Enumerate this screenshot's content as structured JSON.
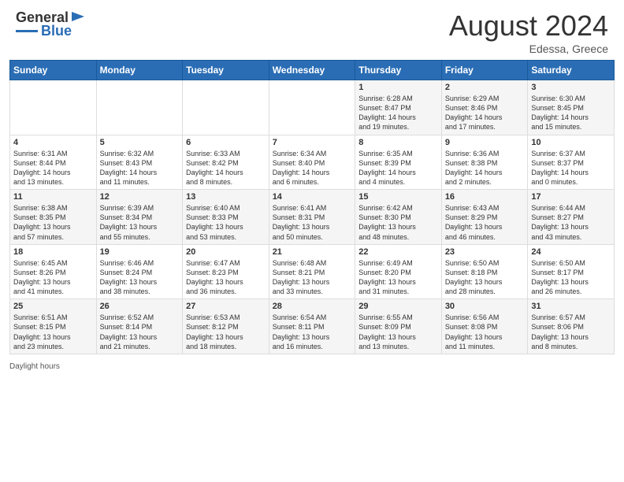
{
  "header": {
    "logo_line1": "General",
    "logo_line2": "Blue",
    "month_year": "August 2024",
    "location": "Edessa, Greece"
  },
  "days_of_week": [
    "Sunday",
    "Monday",
    "Tuesday",
    "Wednesday",
    "Thursday",
    "Friday",
    "Saturday"
  ],
  "weeks": [
    [
      {
        "num": "",
        "info": ""
      },
      {
        "num": "",
        "info": ""
      },
      {
        "num": "",
        "info": ""
      },
      {
        "num": "",
        "info": ""
      },
      {
        "num": "1",
        "info": "Sunrise: 6:28 AM\nSunset: 8:47 PM\nDaylight: 14 hours\nand 19 minutes."
      },
      {
        "num": "2",
        "info": "Sunrise: 6:29 AM\nSunset: 8:46 PM\nDaylight: 14 hours\nand 17 minutes."
      },
      {
        "num": "3",
        "info": "Sunrise: 6:30 AM\nSunset: 8:45 PM\nDaylight: 14 hours\nand 15 minutes."
      }
    ],
    [
      {
        "num": "4",
        "info": "Sunrise: 6:31 AM\nSunset: 8:44 PM\nDaylight: 14 hours\nand 13 minutes."
      },
      {
        "num": "5",
        "info": "Sunrise: 6:32 AM\nSunset: 8:43 PM\nDaylight: 14 hours\nand 11 minutes."
      },
      {
        "num": "6",
        "info": "Sunrise: 6:33 AM\nSunset: 8:42 PM\nDaylight: 14 hours\nand 8 minutes."
      },
      {
        "num": "7",
        "info": "Sunrise: 6:34 AM\nSunset: 8:40 PM\nDaylight: 14 hours\nand 6 minutes."
      },
      {
        "num": "8",
        "info": "Sunrise: 6:35 AM\nSunset: 8:39 PM\nDaylight: 14 hours\nand 4 minutes."
      },
      {
        "num": "9",
        "info": "Sunrise: 6:36 AM\nSunset: 8:38 PM\nDaylight: 14 hours\nand 2 minutes."
      },
      {
        "num": "10",
        "info": "Sunrise: 6:37 AM\nSunset: 8:37 PM\nDaylight: 14 hours\nand 0 minutes."
      }
    ],
    [
      {
        "num": "11",
        "info": "Sunrise: 6:38 AM\nSunset: 8:35 PM\nDaylight: 13 hours\nand 57 minutes."
      },
      {
        "num": "12",
        "info": "Sunrise: 6:39 AM\nSunset: 8:34 PM\nDaylight: 13 hours\nand 55 minutes."
      },
      {
        "num": "13",
        "info": "Sunrise: 6:40 AM\nSunset: 8:33 PM\nDaylight: 13 hours\nand 53 minutes."
      },
      {
        "num": "14",
        "info": "Sunrise: 6:41 AM\nSunset: 8:31 PM\nDaylight: 13 hours\nand 50 minutes."
      },
      {
        "num": "15",
        "info": "Sunrise: 6:42 AM\nSunset: 8:30 PM\nDaylight: 13 hours\nand 48 minutes."
      },
      {
        "num": "16",
        "info": "Sunrise: 6:43 AM\nSunset: 8:29 PM\nDaylight: 13 hours\nand 46 minutes."
      },
      {
        "num": "17",
        "info": "Sunrise: 6:44 AM\nSunset: 8:27 PM\nDaylight: 13 hours\nand 43 minutes."
      }
    ],
    [
      {
        "num": "18",
        "info": "Sunrise: 6:45 AM\nSunset: 8:26 PM\nDaylight: 13 hours\nand 41 minutes."
      },
      {
        "num": "19",
        "info": "Sunrise: 6:46 AM\nSunset: 8:24 PM\nDaylight: 13 hours\nand 38 minutes."
      },
      {
        "num": "20",
        "info": "Sunrise: 6:47 AM\nSunset: 8:23 PM\nDaylight: 13 hours\nand 36 minutes."
      },
      {
        "num": "21",
        "info": "Sunrise: 6:48 AM\nSunset: 8:21 PM\nDaylight: 13 hours\nand 33 minutes."
      },
      {
        "num": "22",
        "info": "Sunrise: 6:49 AM\nSunset: 8:20 PM\nDaylight: 13 hours\nand 31 minutes."
      },
      {
        "num": "23",
        "info": "Sunrise: 6:50 AM\nSunset: 8:18 PM\nDaylight: 13 hours\nand 28 minutes."
      },
      {
        "num": "24",
        "info": "Sunrise: 6:50 AM\nSunset: 8:17 PM\nDaylight: 13 hours\nand 26 minutes."
      }
    ],
    [
      {
        "num": "25",
        "info": "Sunrise: 6:51 AM\nSunset: 8:15 PM\nDaylight: 13 hours\nand 23 minutes."
      },
      {
        "num": "26",
        "info": "Sunrise: 6:52 AM\nSunset: 8:14 PM\nDaylight: 13 hours\nand 21 minutes."
      },
      {
        "num": "27",
        "info": "Sunrise: 6:53 AM\nSunset: 8:12 PM\nDaylight: 13 hours\nand 18 minutes."
      },
      {
        "num": "28",
        "info": "Sunrise: 6:54 AM\nSunset: 8:11 PM\nDaylight: 13 hours\nand 16 minutes."
      },
      {
        "num": "29",
        "info": "Sunrise: 6:55 AM\nSunset: 8:09 PM\nDaylight: 13 hours\nand 13 minutes."
      },
      {
        "num": "30",
        "info": "Sunrise: 6:56 AM\nSunset: 8:08 PM\nDaylight: 13 hours\nand 11 minutes."
      },
      {
        "num": "31",
        "info": "Sunrise: 6:57 AM\nSunset: 8:06 PM\nDaylight: 13 hours\nand 8 minutes."
      }
    ]
  ],
  "footer": {
    "daylight_label": "Daylight hours"
  }
}
